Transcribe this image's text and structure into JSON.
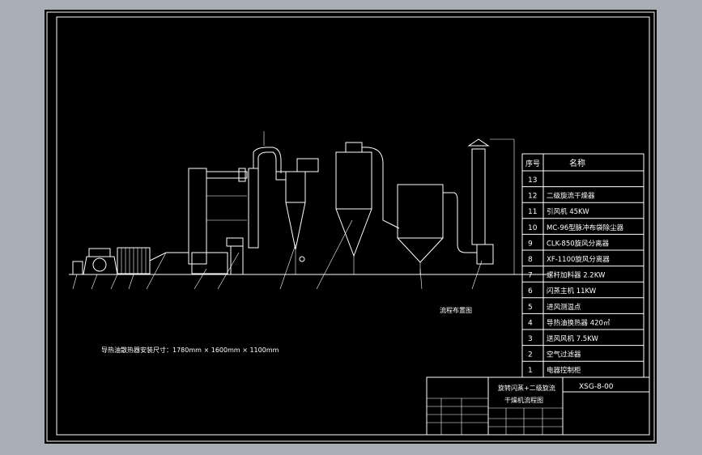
{
  "drawing": {
    "layout_title": "流程布置图",
    "install_note": "导热油散热器安装尺寸：1780mm × 1600mm × 1100mm",
    "parts_header": {
      "no": "序号",
      "name": "名称"
    },
    "parts": [
      {
        "no": "13",
        "name": ""
      },
      {
        "no": "12",
        "name": "二级旋流干燥器"
      },
      {
        "no": "11",
        "name": "引风机    45KW"
      },
      {
        "no": "10",
        "name": "MC-96型脉冲布袋除尘器"
      },
      {
        "no": "9",
        "name": "CLK-850旋风分离器"
      },
      {
        "no": "8",
        "name": "XF-1100旋风分离器"
      },
      {
        "no": "7",
        "name": "螺杆加料器  2.2KW"
      },
      {
        "no": "6",
        "name": "闪蒸主机  11KW"
      },
      {
        "no": "5",
        "name": "进风测温点"
      },
      {
        "no": "4",
        "name": "导热油换热器  420㎡"
      },
      {
        "no": "3",
        "name": "送风风机  7.5KW"
      },
      {
        "no": "2",
        "name": "空气过滤器"
      },
      {
        "no": "1",
        "name": "电器控制柜"
      }
    ],
    "title_block": {
      "drawing_no": "XSG-8-00",
      "title_line1": "旋转闪蒸+二级旋流",
      "title_line2": "干燥机流程图"
    }
  },
  "colors": {
    "background": "#000000",
    "line": "#ffffff",
    "surround": "#a9adb6"
  }
}
